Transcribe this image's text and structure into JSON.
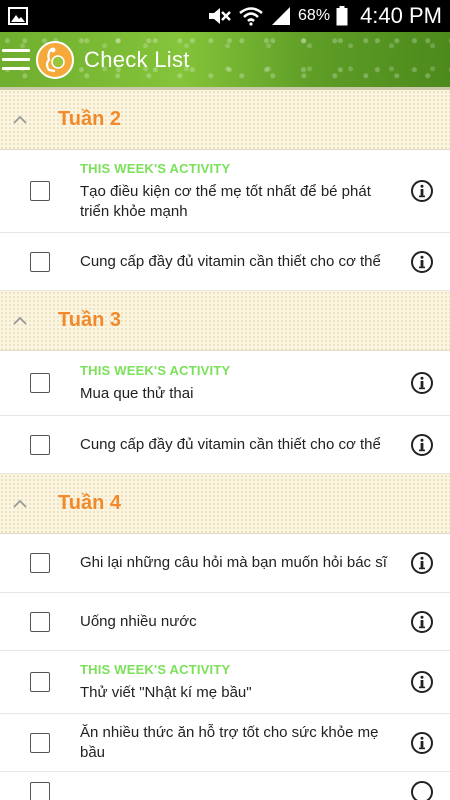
{
  "status_bar": {
    "battery_percent": "68%",
    "time": "4:40 PM"
  },
  "app_bar": {
    "title": "Check List"
  },
  "sections": [
    {
      "title": "Tuần 2",
      "items": [
        {
          "tag": "THIS WEEK'S ACTIVITY",
          "text": "Tạo điều kiện cơ thể mẹ tốt nhất để bé phát triển khỏe mạnh"
        },
        {
          "tag": "",
          "text": "Cung cấp đầy đủ vitamin cần thiết cho cơ thể"
        }
      ]
    },
    {
      "title": "Tuần 3",
      "items": [
        {
          "tag": "THIS WEEK'S ACTIVITY",
          "text": "Mua que thử thai"
        },
        {
          "tag": "",
          "text": "Cung cấp đầy đủ vitamin cần thiết cho cơ thể"
        }
      ]
    },
    {
      "title": "Tuần 4",
      "items": [
        {
          "tag": "",
          "text": "Ghi lại những câu hỏi mà bạn muốn hỏi bác sĩ"
        },
        {
          "tag": "",
          "text": "Uống nhiều nước"
        },
        {
          "tag": "THIS WEEK'S ACTIVITY",
          "text": "Thử viết \"Nhật kí mẹ bầu\""
        },
        {
          "tag": "",
          "text": "Ăn nhiều thức ăn hỗ trợ tốt cho sức khỏe mẹ bầu"
        }
      ]
    }
  ]
}
